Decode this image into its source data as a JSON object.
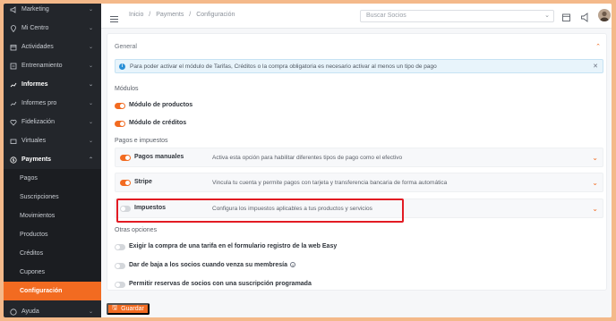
{
  "sidebar": {
    "items": [
      {
        "label": "Marketing",
        "icon": "megaphone-icon"
      },
      {
        "label": "Mi Centro",
        "icon": "location-icon"
      },
      {
        "label": "Actividades",
        "icon": "calendar-icon"
      },
      {
        "label": "Entrenamiento",
        "icon": "dumbbell-icon"
      },
      {
        "label": "Informes",
        "icon": "chart-icon"
      },
      {
        "label": "Informes pro",
        "icon": "chart-pro-icon"
      },
      {
        "label": "Fidelización",
        "icon": "heart-icon"
      },
      {
        "label": "Virtuales",
        "icon": "video-icon"
      },
      {
        "label": "Payments",
        "icon": "dollar-icon"
      }
    ],
    "payments_sub": [
      "Pagos",
      "Suscripciones",
      "Movimientos",
      "Productos",
      "Créditos",
      "Cupones",
      "Configuración"
    ],
    "bottom_item": {
      "label": "Ayuda",
      "icon": "help-icon"
    }
  },
  "header": {
    "breadcrumb": [
      "Inicio",
      "/",
      "Payments",
      "/",
      "Configuración"
    ],
    "search_placeholder": "Buscar Socios"
  },
  "general": {
    "title": "General",
    "alert": "Para poder activar el módulo de Tarifas, Créditos o la compra obligatoria es necesario activar al menos un tipo de pago",
    "modules_title": "Módulos",
    "module_products": "Módulo de productos",
    "module_credits": "Módulo de créditos",
    "payments_title": "Pagos e impuestos",
    "rows": [
      {
        "label": "Pagos manuales",
        "desc": "Activa esta opción para habilitar diferentes tipos de pago como el efectivo",
        "on": true
      },
      {
        "label": "Stripe",
        "desc": "Vincula tu cuenta y permite pagos con tarjeta y transferencia bancaria de forma automática",
        "on": true
      },
      {
        "label": "Impuestos",
        "desc": "Configura los impuestos aplicables a tus productos y servicios",
        "on": false
      }
    ],
    "other_title": "Otras opciones",
    "other_options": [
      "Exigir la compra de una tarifa en el formulario registro de la web Easy",
      "Dar de baja a los socios cuando venza su membresía",
      "Permitir reservas de socios con una suscripción programada"
    ]
  },
  "actions": {
    "save": "Guardar"
  },
  "colors": {
    "accent": "#f26b21",
    "sidebar": "#23262b",
    "highlight": "#e21b23"
  }
}
